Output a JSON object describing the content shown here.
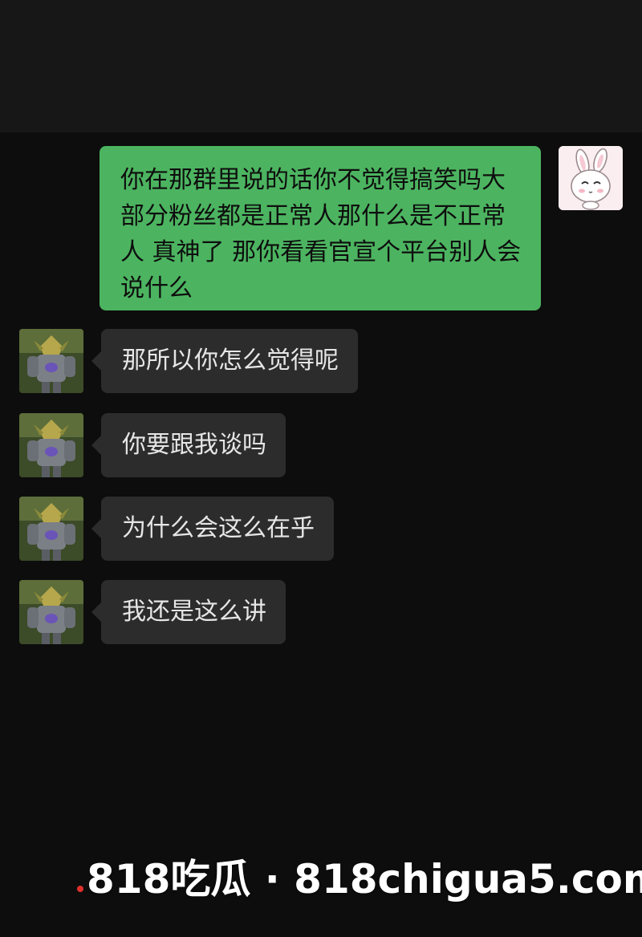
{
  "messages": [
    {
      "side": "outgoing",
      "text": "你在那群里说的话你不觉得搞笑吗大部分粉丝都是正常人那什么是不正常人 真神了 那你看看官宣个平台别人会说什么"
    },
    {
      "side": "incoming",
      "text": "那所以你怎么觉得呢"
    },
    {
      "side": "incoming",
      "text": "你要跟我谈吗"
    },
    {
      "side": "incoming",
      "text": "为什么会这么在乎"
    },
    {
      "side": "incoming",
      "text": "我还是这么讲"
    }
  ],
  "avatars": {
    "self": "bunny-avatar-icon",
    "peer": "armored-warrior-avatar-icon"
  },
  "watermark": {
    "text": "818吃瓜 · 818chigua5.com"
  },
  "colors": {
    "outgoing_bubble": "#4cb460",
    "incoming_bubble": "#2c2c2c",
    "background": "#0d0d0d",
    "watermark_dot": "#e0302c"
  }
}
